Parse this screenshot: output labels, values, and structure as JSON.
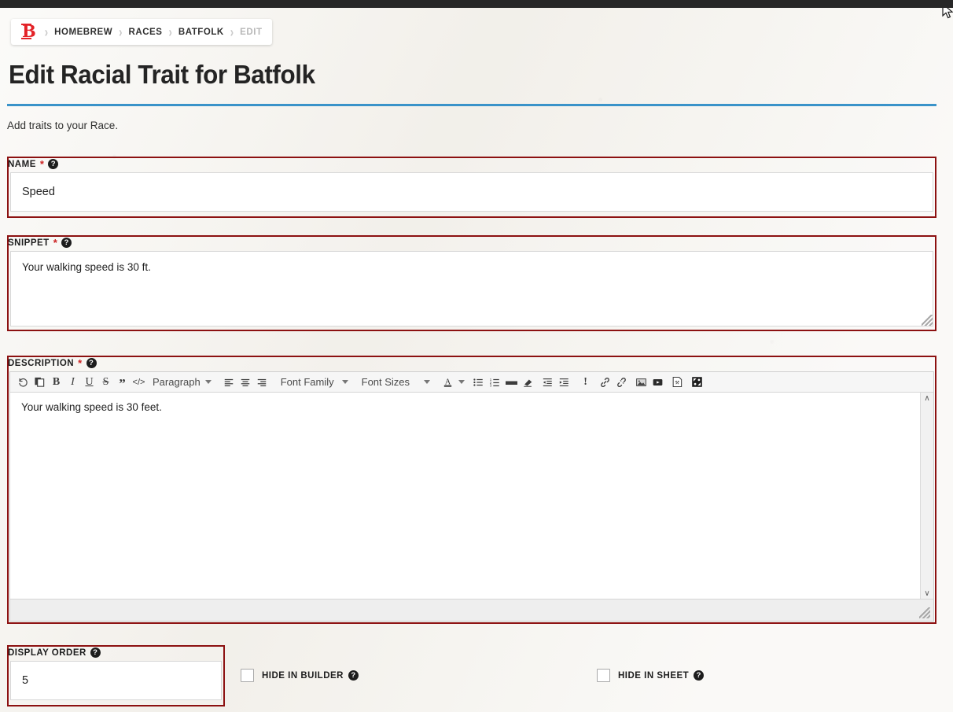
{
  "window": {
    "topbar_color": "#272727"
  },
  "breadcrumb": {
    "logo": "B",
    "separator": "›",
    "items": [
      {
        "label": "HOMEBREW",
        "current": false
      },
      {
        "label": "RACES",
        "current": false
      },
      {
        "label": "BATFOLK",
        "current": false
      },
      {
        "label": "EDIT",
        "current": true
      }
    ]
  },
  "header": {
    "title": "Edit Racial Trait for Batfolk",
    "subtitle": "Add traits to your Race.",
    "rule_color": "#3a93c9"
  },
  "fields": {
    "name": {
      "label": "NAME",
      "required": "*",
      "help": "?",
      "value": "Speed",
      "placeholder": ""
    },
    "snippet": {
      "label": "SNIPPET",
      "required": "*",
      "help": "?",
      "value": "Your walking speed is 30 ft.",
      "placeholder": ""
    },
    "description": {
      "label": "DESCRIPTION",
      "required": "*",
      "help": "?",
      "value": "Your walking speed is 30 feet."
    },
    "display_order": {
      "label": "DISPLAY ORDER",
      "help": "?",
      "value": "5",
      "placeholder": ""
    }
  },
  "editor": {
    "block_format": "Paragraph",
    "font_family": "Font Family",
    "font_sizes": "Font Sizes",
    "toolbar": [
      {
        "name": "undo-icon",
        "glyph": "↺",
        "type": "icon"
      },
      {
        "name": "paste-icon",
        "glyph": "❐",
        "type": "icon"
      },
      {
        "name": "bold-icon",
        "glyph": "B",
        "type": "icon"
      },
      {
        "name": "italic-icon",
        "glyph": "I",
        "type": "icon"
      },
      {
        "name": "underline-icon",
        "glyph": "U",
        "type": "icon"
      },
      {
        "name": "strikethrough-icon",
        "glyph": "S",
        "type": "icon"
      },
      {
        "name": "blockquote-icon",
        "glyph": "”",
        "type": "icon"
      },
      {
        "name": "code-icon",
        "glyph": "</>",
        "type": "icon"
      },
      {
        "name": "block-format-select",
        "glyph": "Paragraph",
        "type": "select"
      },
      {
        "name": "align-left-icon",
        "glyph": "≡",
        "type": "icon"
      },
      {
        "name": "align-center-icon",
        "glyph": "≡",
        "type": "icon"
      },
      {
        "name": "align-right-icon",
        "glyph": "≡",
        "type": "icon"
      },
      {
        "name": "font-family-select",
        "glyph": "Font Family",
        "type": "select"
      },
      {
        "name": "font-size-select",
        "glyph": "Font Sizes",
        "type": "select"
      },
      {
        "name": "text-color-icon",
        "glyph": "A",
        "type": "icon"
      },
      {
        "name": "bullet-list-icon",
        "glyph": "☰",
        "type": "icon"
      },
      {
        "name": "numbered-list-icon",
        "glyph": "☰",
        "type": "icon"
      },
      {
        "name": "horizontal-rule-icon",
        "glyph": "—",
        "type": "icon"
      },
      {
        "name": "clear-formatting-icon",
        "glyph": "▰",
        "type": "icon"
      },
      {
        "name": "outdent-icon",
        "glyph": "≡",
        "type": "icon"
      },
      {
        "name": "indent-icon",
        "glyph": "≡",
        "type": "icon"
      },
      {
        "name": "special-character-icon",
        "glyph": "!",
        "type": "icon"
      },
      {
        "name": "insert-link-icon",
        "glyph": "⚭",
        "type": "icon"
      },
      {
        "name": "unlink-icon",
        "glyph": "⚮",
        "type": "icon"
      },
      {
        "name": "insert-image-icon",
        "glyph": "ὛC",
        "type": "icon"
      },
      {
        "name": "insert-video-icon",
        "glyph": "▶",
        "type": "icon"
      },
      {
        "name": "source-code-icon",
        "glyph": "⎙",
        "type": "icon"
      },
      {
        "name": "fullscreen-icon",
        "glyph": "⬛",
        "type": "icon"
      }
    ],
    "scroll_up": "∧",
    "scroll_down": "∨"
  },
  "checkboxes": [
    {
      "name": "hide-in-builder",
      "label": "HIDE IN BUILDER",
      "help": "?",
      "checked": false
    },
    {
      "name": "hide-in-sheet",
      "label": "HIDE IN SHEET",
      "help": "?",
      "checked": false
    }
  ],
  "colors": {
    "validation_border": "#8c1111",
    "accent": "#3a93c9",
    "brand_red": "#e32227"
  }
}
